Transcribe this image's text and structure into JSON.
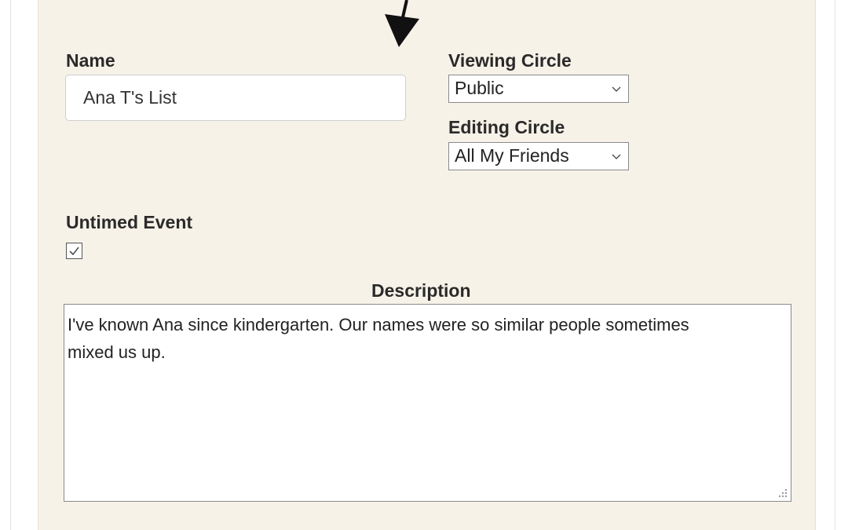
{
  "form": {
    "name_label": "Name",
    "name_value": "Ana T's List",
    "viewing_circle_label": "Viewing Circle",
    "viewing_circle_value": "Public",
    "editing_circle_label": "Editing Circle",
    "editing_circle_value": "All My Friends",
    "untimed_event_label": "Untimed Event",
    "untimed_event_checked": true,
    "description_label": "Description",
    "description_value": "I've known Ana since kindergarten. Our names were so similar people sometimes mixed us up."
  },
  "icons": {
    "pointer": "arrow-pointer-icon",
    "dropdown": "chevron-down-icon",
    "check": "checkmark-icon",
    "resize": "resize-grip-icon"
  },
  "colors": {
    "panel_background": "#f7f2e8",
    "page_background": "#ffffff",
    "label_text": "#2a2a2a"
  }
}
